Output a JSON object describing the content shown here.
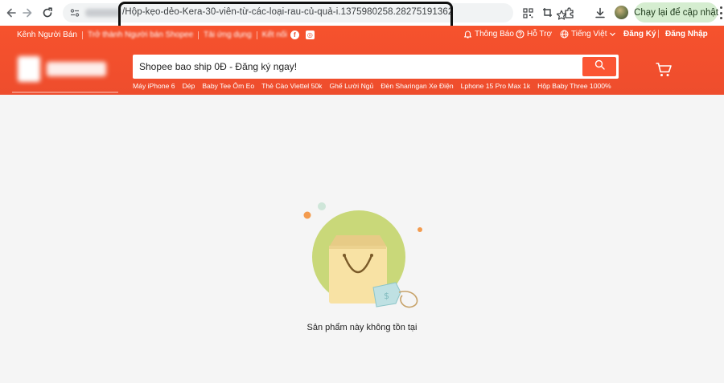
{
  "browser": {
    "url_path": "/Hộp-kẹo-dẻo-Kera-30-viên-từ-các-loại-rau-củ-quả-i.1375980258.28275191362",
    "update_button": "Chạy lại để cập nhật",
    "icons": [
      "back-icon",
      "forward-icon",
      "reload-icon",
      "site-info-icon",
      "bookmark-star-icon",
      "qr-code-icon",
      "screenshot-icon",
      "extensions-icon",
      "download-icon",
      "profile-avatar",
      "kebab-menu-icon"
    ]
  },
  "topbar": {
    "seller_channel": "Kênh Người Bán",
    "become_seller": "Trở thành Người bán Shopee",
    "download_app": "Tải ứng dụng",
    "connect": "Kết nối",
    "notifications": "Thông Báo",
    "support": "Hỗ Trợ",
    "language": "Tiếng Việt",
    "register": "Đăng Ký",
    "login": "Đăng Nhập"
  },
  "search": {
    "placeholder": "Shopee bao ship 0Đ - Đăng ký ngay!",
    "suggestions": [
      "Máy iPhone 6",
      "Dép",
      "Baby Tee Ôm Eo",
      "Thẻ Cào Viettel 50k",
      "Ghế Lười Ngủ",
      "Đèn Sharingan Xe Điện",
      "Lphone 15 Pro Max 1k",
      "Hộp Baby Three 1000%"
    ]
  },
  "main": {
    "empty_message": "Sản phẩm này không tồn tại"
  },
  "colors": {
    "brand": "#ee4d2d",
    "page_bg": "#f5f5f5",
    "update_btn_bg": "#d5edd0"
  }
}
